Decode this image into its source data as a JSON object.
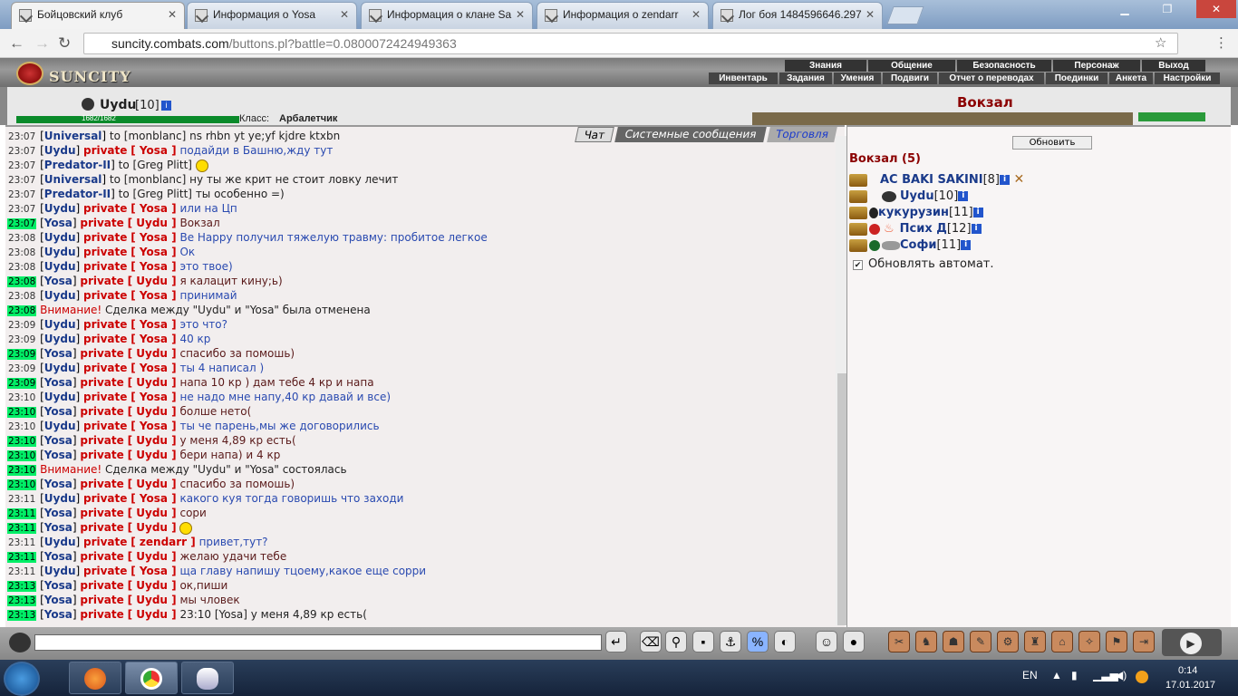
{
  "browser": {
    "tabs": [
      {
        "title": "Бойцовский клуб",
        "active": true
      },
      {
        "title": "Информация о Yosa",
        "active": false
      },
      {
        "title": "Информация о клане Sa",
        "active": false
      },
      {
        "title": "Информация о zendarr",
        "active": false
      },
      {
        "title": "Лог боя 1484596646.297",
        "active": false
      }
    ],
    "url_host": "suncity.combats.com",
    "url_path": "/buttons.pl?battle=0.0800072424949363"
  },
  "site": {
    "logo": "SUNCITY",
    "menu_top": [
      "Знания",
      "Общение",
      "Безопасность",
      "Персонаж",
      "Выход"
    ],
    "menu_bottom": [
      "Инвентарь",
      "Задания",
      "Умения",
      "Подвиги",
      "Отчет о переводах",
      "Поединки",
      "Анкета",
      "Настройки"
    ],
    "player_name": "Uydu",
    "player_level": "[10]",
    "hp": "1682/1682",
    "class_label": "Класс:",
    "class_value": "Арбалетчик",
    "location_title": "Вокзал"
  },
  "chat": {
    "tabs": [
      "Чат",
      "Системные сообщения",
      "Торговля"
    ],
    "messages": [
      {
        "t": "23:07",
        "hl": false,
        "from": "Universal",
        "mode": "to",
        "target": "[monblanc]",
        "text": "ns rhbn yt ye;yf kjdre ktxbn",
        "color": "dark"
      },
      {
        "t": "23:07",
        "hl": false,
        "from": "Uydu",
        "mode": "private",
        "target": "[ Yosa ]",
        "text": "подайди в Башню,жду тут",
        "color": "blue"
      },
      {
        "t": "23:07",
        "hl": false,
        "from": "Predator-II",
        "mode": "to",
        "target": "[Greg Plitt]",
        "text": "",
        "color": "dark",
        "smile": true
      },
      {
        "t": "23:07",
        "hl": false,
        "from": "Universal",
        "mode": "to",
        "target": "[monblanc]",
        "text": "ну ты же крит не стоит ловку лечит",
        "color": "dark"
      },
      {
        "t": "23:07",
        "hl": false,
        "from": "Predator-II",
        "mode": "to",
        "target": "[Greg Plitt]",
        "text": "ты особенно =)",
        "color": "dark"
      },
      {
        "t": "23:07",
        "hl": false,
        "from": "Uydu",
        "mode": "private",
        "target": "[ Yosa ]",
        "text": "или на Цп",
        "color": "blue"
      },
      {
        "t": "23:07",
        "hl": true,
        "from": "Yosa",
        "mode": "private",
        "target": "[ Uydu ]",
        "text": "Вокзал",
        "color": "brown"
      },
      {
        "t": "23:08",
        "hl": false,
        "from": "Uydu",
        "mode": "private",
        "target": "[ Yosa ]",
        "text": "Be Happy получил тяжелую травму: пробитое легкое",
        "color": "blue"
      },
      {
        "t": "23:08",
        "hl": false,
        "from": "Uydu",
        "mode": "private",
        "target": "[ Yosa ]",
        "text": "Ок",
        "color": "blue"
      },
      {
        "t": "23:08",
        "hl": false,
        "from": "Uydu",
        "mode": "private",
        "target": "[ Yosa ]",
        "text": "это твое)",
        "color": "blue"
      },
      {
        "t": "23:08",
        "hl": true,
        "from": "Yosa",
        "mode": "private",
        "target": "[ Uydu ]",
        "text": "я калацит кину;ь)",
        "color": "brown"
      },
      {
        "t": "23:08",
        "hl": false,
        "from": "Uydu",
        "mode": "private",
        "target": "[ Yosa ]",
        "text": "принимай",
        "color": "blue"
      },
      {
        "t": "23:08",
        "hl": true,
        "att": "Внимание!",
        "text": "Сделка между \"Uydu\" и \"Yosa\" была отменена",
        "color": "dark"
      },
      {
        "t": "23:09",
        "hl": false,
        "from": "Uydu",
        "mode": "private",
        "target": "[ Yosa ]",
        "text": "это что?",
        "color": "blue"
      },
      {
        "t": "23:09",
        "hl": false,
        "from": "Uydu",
        "mode": "private",
        "target": "[ Yosa ]",
        "text": "40 кр",
        "color": "blue"
      },
      {
        "t": "23:09",
        "hl": true,
        "from": "Yosa",
        "mode": "private",
        "target": "[ Uydu ]",
        "text": "спасибо за помошь)",
        "color": "brown"
      },
      {
        "t": "23:09",
        "hl": false,
        "from": "Uydu",
        "mode": "private",
        "target": "[ Yosa ]",
        "text": "ты 4 написал )",
        "color": "blue"
      },
      {
        "t": "23:09",
        "hl": true,
        "from": "Yosa",
        "mode": "private",
        "target": "[ Uydu ]",
        "text": "напа 10 кр ) дам тебе 4 кр и напа",
        "color": "brown"
      },
      {
        "t": "23:10",
        "hl": false,
        "from": "Uydu",
        "mode": "private",
        "target": "[ Yosa ]",
        "text": "не надо мне напу,40 кр давай и все)",
        "color": "blue"
      },
      {
        "t": "23:10",
        "hl": true,
        "from": "Yosa",
        "mode": "private",
        "target": "[ Uydu ]",
        "text": "болше нето(",
        "color": "brown"
      },
      {
        "t": "23:10",
        "hl": false,
        "from": "Uydu",
        "mode": "private",
        "target": "[ Yosa ]",
        "text": "ты че парень,мы же договорились",
        "color": "blue"
      },
      {
        "t": "23:10",
        "hl": true,
        "from": "Yosa",
        "mode": "private",
        "target": "[ Uydu ]",
        "text": "у меня 4,89 кр есть(",
        "color": "brown"
      },
      {
        "t": "23:10",
        "hl": true,
        "from": "Yosa",
        "mode": "private",
        "target": "[ Uydu ]",
        "text": "бери напа) и 4 кр",
        "color": "brown"
      },
      {
        "t": "23:10",
        "hl": true,
        "att": "Внимание!",
        "text": "Сделка между \"Uydu\" и \"Yosa\" состоялась",
        "color": "dark"
      },
      {
        "t": "23:10",
        "hl": true,
        "from": "Yosa",
        "mode": "private",
        "target": "[ Uydu ]",
        "text": "спасибо за помошь)",
        "color": "brown"
      },
      {
        "t": "23:11",
        "hl": false,
        "from": "Uydu",
        "mode": "private",
        "target": "[ Yosa ]",
        "text": "какого куя тогда говоришь что заходи",
        "color": "blue"
      },
      {
        "t": "23:11",
        "hl": true,
        "from": "Yosa",
        "mode": "private",
        "target": "[ Uydu ]",
        "text": "сори",
        "color": "brown"
      },
      {
        "t": "23:11",
        "hl": true,
        "from": "Yosa",
        "mode": "private",
        "target": "[ Uydu ]",
        "text": "",
        "color": "brown",
        "smile": true
      },
      {
        "t": "23:11",
        "hl": false,
        "from": "Uydu",
        "mode": "private",
        "target": "[ zendarr ]",
        "text": "привет,тут?",
        "color": "blue"
      },
      {
        "t": "23:11",
        "hl": true,
        "from": "Yosa",
        "mode": "private",
        "target": "[ Uydu ]",
        "text": "желаю удачи тебе",
        "color": "brown"
      },
      {
        "t": "23:11",
        "hl": false,
        "from": "Uydu",
        "mode": "private",
        "target": "[ Yosa ]",
        "text": "ща главу напишу тцоему,какое еще сорри",
        "color": "blue"
      },
      {
        "t": "23:13",
        "hl": true,
        "from": "Yosa",
        "mode": "private",
        "target": "[ Uydu ]",
        "text": "ок,пиши",
        "color": "brown"
      },
      {
        "t": "23:13",
        "hl": true,
        "from": "Yosa",
        "mode": "private",
        "target": "[ Uydu ]",
        "text": "мы чловек",
        "color": "brown"
      },
      {
        "t": "23:13",
        "hl": true,
        "from": "Yosa",
        "mode": "private",
        "target": "[ Uydu ]",
        "text": "23:10 [Yosa] у меня 4,89 кр есть(",
        "color": "dark"
      }
    ]
  },
  "sidebar": {
    "refresh_button": "Обновить",
    "title": "Вокзал (5)",
    "players": [
      {
        "name": "AC BAKI SAKINI",
        "level": "[8]"
      },
      {
        "name": "Uydu",
        "level": "[10]"
      },
      {
        "name": "кукурузин",
        "level": "[11]"
      },
      {
        "name": "Псих Д",
        "level": "[12]"
      },
      {
        "name": "Софи",
        "level": "[11]"
      }
    ],
    "auto_refresh": "Обновлять автомат."
  },
  "taskbar": {
    "lang": "EN",
    "time": "0:14",
    "date": "17.01.2017"
  }
}
